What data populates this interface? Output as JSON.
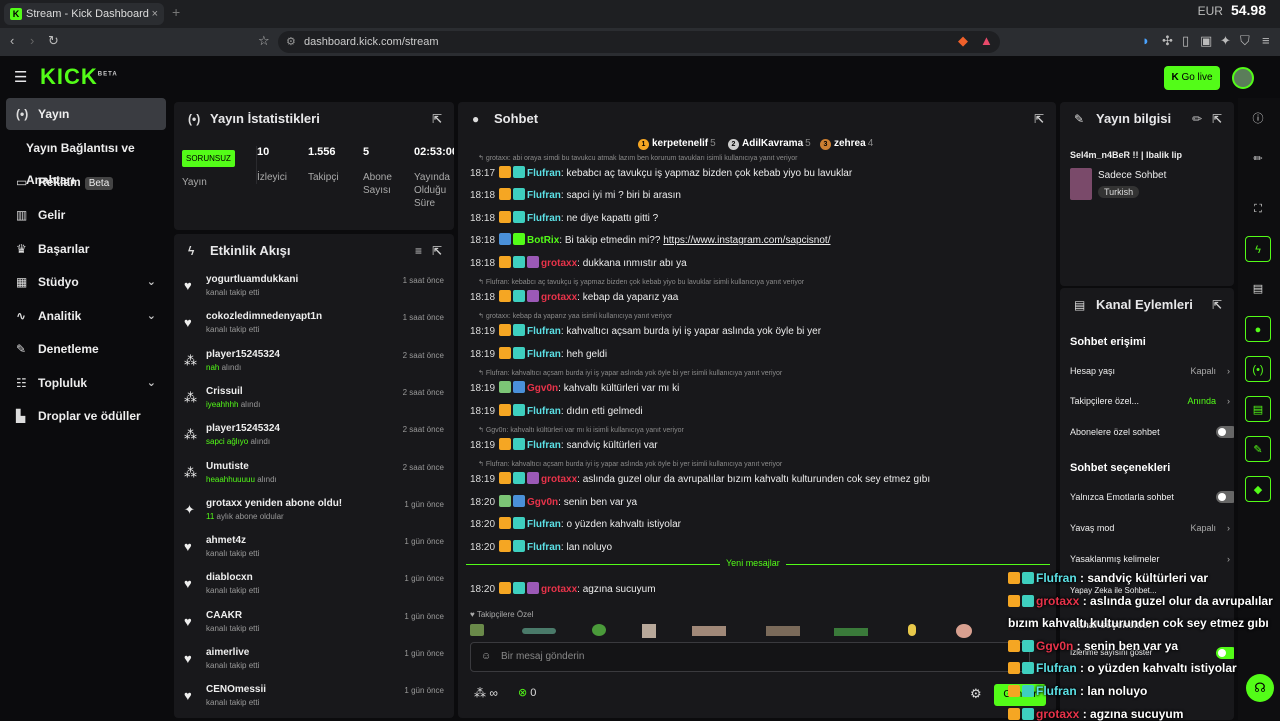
{
  "browser": {
    "tab_title": "Stream - Kick Dashboard",
    "new_tab": "+",
    "close": "×",
    "url": "dashboard.kick.com/stream",
    "ticker_label": "EUR",
    "ticker_value": "54.98"
  },
  "app": {
    "logo": "KICK",
    "logo_tag": "BETA",
    "go_live": "Go live"
  },
  "sidebar": {
    "items": [
      {
        "label": "Yayın",
        "icon": "broadcast-icon"
      },
      {
        "label": "Yayın Bağlantısı ve Anahtarı",
        "icon": ""
      },
      {
        "label": "Reklam",
        "icon": "tv-icon",
        "badge": "Beta"
      },
      {
        "label": "Gelir",
        "icon": "chart-icon"
      },
      {
        "label": "Başarılar",
        "icon": "trophy-icon"
      },
      {
        "label": "Stüdyo",
        "icon": "studio-icon"
      },
      {
        "label": "Analitik",
        "icon": "analytics-icon"
      },
      {
        "label": "Denetleme",
        "icon": "wrench-icon"
      },
      {
        "label": "Topluluk",
        "icon": "community-icon"
      },
      {
        "label": "Droplar ve ödüller",
        "icon": "drops-icon"
      }
    ]
  },
  "stats": {
    "title": "Yayın İstatistikleri",
    "status": "SORUNSUZ",
    "status_label": "Yayın",
    "viewers": "10",
    "viewers_label": "İzleyici",
    "followers": "1.556",
    "followers_label": "Takipçi",
    "subs": "5",
    "subs_label": "Abone Sayısı",
    "duration": "02:53:00",
    "duration_label": "Yayında Olduğu Süre"
  },
  "activity": {
    "title": "Etkinlik Akışı",
    "items": [
      {
        "name": "yogurtluamdukkani",
        "sub": "kanalı takip etti",
        "hl": "",
        "time": "1 saat önce",
        "icon": "heart-icon"
      },
      {
        "name": "cokozledimnedenyapt1n",
        "sub": "kanalı takip etti",
        "hl": "",
        "time": "1 saat önce",
        "icon": "heart-icon"
      },
      {
        "name": "player15245324",
        "sub": "alındı",
        "hl": "nah",
        "time": "2 saat önce",
        "icon": "reward-icon"
      },
      {
        "name": "Crissuil",
        "sub": "alındı",
        "hl": "iyeahhhh",
        "time": "2 saat önce",
        "icon": "reward-icon"
      },
      {
        "name": "player15245324",
        "sub": "alındı",
        "hl": "sapci ağlıyo",
        "time": "2 saat önce",
        "icon": "reward-icon"
      },
      {
        "name": "Umutiste",
        "sub": "alındı",
        "hl": "heaahhuuuuu",
        "time": "2 saat önce",
        "icon": "reward-icon"
      },
      {
        "name": "grotaxx yeniden abone oldu!",
        "sub": "aylık abone oldular",
        "hl": "11",
        "time": "1 gün önce",
        "icon": "star-icon"
      },
      {
        "name": "ahmet4z",
        "sub": "kanalı takip etti",
        "hl": "",
        "time": "1 gün önce",
        "icon": "heart-icon"
      },
      {
        "name": "diablocxn",
        "sub": "kanalı takip etti",
        "hl": "",
        "time": "1 gün önce",
        "icon": "heart-icon"
      },
      {
        "name": "CAAKR",
        "sub": "kanalı takip etti",
        "hl": "",
        "time": "1 gün önce",
        "icon": "heart-icon"
      },
      {
        "name": "aimerlive",
        "sub": "kanalı takip etti",
        "hl": "",
        "time": "1 gün önce",
        "icon": "heart-icon"
      },
      {
        "name": "CENOmessii",
        "sub": "kanalı takip etti",
        "hl": "",
        "time": "1 gün önce",
        "icon": "heart-icon"
      }
    ]
  },
  "chat": {
    "title": "Sohbet",
    "top": [
      {
        "rank": "1",
        "name": "kerpetenelif",
        "count": "5"
      },
      {
        "rank": "2",
        "name": "AdilKavrama",
        "count": "5"
      },
      {
        "rank": "3",
        "name": "zehrea",
        "count": "4"
      }
    ],
    "lines": [
      {
        "kind": "reply",
        "text": "grotaxx: abi oraya simdi bu tavukcu atmak lazım ben korurum tavukları isimli kullanıcıya yanıt veriyor"
      },
      {
        "kind": "msg",
        "time": "18:17",
        "user": "Flufran",
        "color": "#5ce1e6",
        "text": ": kebabcı aç tavukçu iş yapmaz bizden çok kebab yiyo bu lavuklar",
        "badges": [
          "#f5a623",
          "#3ecfbf"
        ]
      },
      {
        "kind": "msg",
        "time": "18:18",
        "user": "Flufran",
        "color": "#5ce1e6",
        "text": ": sapci iyi mi ? biri bi arasın",
        "badges": [
          "#f5a623",
          "#3ecfbf"
        ]
      },
      {
        "kind": "msg",
        "time": "18:18",
        "user": "Flufran",
        "color": "#5ce1e6",
        "text": ": ne diye kapattı gitti ?",
        "badges": [
          "#f5a623",
          "#3ecfbf"
        ]
      },
      {
        "kind": "msg",
        "time": "18:18",
        "user": "BotRix",
        "color": "#53fc18",
        "text": ": Bi takip etmedin mi?? ",
        "link": "https://www.instagram.com/sapcisnot/",
        "badges": [
          "#4a90d9",
          "#53fc18"
        ]
      },
      {
        "kind": "msg",
        "time": "18:18",
        "user": "grotaxx",
        "color": "#e8334a",
        "text": ": dukkana ınmıstır abı ya",
        "badges": [
          "#f5a623",
          "#3ecfbf",
          "#9b59b6"
        ]
      },
      {
        "kind": "reply",
        "text": "Flufran: kebabcı aç tavukçu iş yapmaz bizden çok kebab yiyo bu lavuklar isimli kullanıcıya yanıt veriyor"
      },
      {
        "kind": "msg",
        "time": "18:18",
        "user": "grotaxx",
        "color": "#e8334a",
        "text": ": kebap da yaparız yaa",
        "badges": [
          "#f5a623",
          "#3ecfbf",
          "#9b59b6"
        ]
      },
      {
        "kind": "reply",
        "text": "grotaxx: kebap da yaparız yaa isimli kullanıcıya yanıt veriyor"
      },
      {
        "kind": "msg",
        "time": "18:19",
        "user": "Flufran",
        "color": "#5ce1e6",
        "text": ": kahvaltıcı açsam burda iyi iş yapar aslında yok öyle bi yer",
        "badges": [
          "#f5a623",
          "#3ecfbf"
        ]
      },
      {
        "kind": "msg",
        "time": "18:19",
        "user": "Flufran",
        "color": "#5ce1e6",
        "text": ": heh geldi",
        "badges": [
          "#f5a623",
          "#3ecfbf"
        ]
      },
      {
        "kind": "reply",
        "text": "Flufran: kahvaltıcı açsam burda iyi iş yapar aslında yok öyle bi yer isimli kullanıcıya yanıt veriyor"
      },
      {
        "kind": "msg",
        "time": "18:19",
        "user": "Ggv0n",
        "color": "#e8334a",
        "text": ": kahvaltı kültürleri var mı ki",
        "badges": [
          "#7cc576",
          "#4a90d9"
        ]
      },
      {
        "kind": "msg",
        "time": "18:19",
        "user": "Flufran",
        "color": "#5ce1e6",
        "text": ": dıdın etti gelmedi",
        "badges": [
          "#f5a623",
          "#3ecfbf"
        ]
      },
      {
        "kind": "reply",
        "text": "Ggv0n: kahvaltı kültürleri var mı ki isimli kullanıcıya yanıt veriyor"
      },
      {
        "kind": "msg",
        "time": "18:19",
        "user": "Flufran",
        "color": "#5ce1e6",
        "text": ": sandviç kültürleri var",
        "badges": [
          "#f5a623",
          "#3ecfbf"
        ]
      },
      {
        "kind": "reply",
        "text": "Flufran: kahvaltıcı açsam burda iyi iş yapar aslında yok öyle bi yer isimli kullanıcıya yanıt veriyor"
      },
      {
        "kind": "msg",
        "time": "18:19",
        "user": "grotaxx",
        "color": "#e8334a",
        "text": ": aslında guzel olur da avrupalılar bızım kahvaltı kulturunden cok sey etmez gıbı",
        "badges": [
          "#f5a623",
          "#3ecfbf",
          "#9b59b6"
        ]
      },
      {
        "kind": "msg",
        "time": "18:20",
        "user": "Ggv0n",
        "color": "#e8334a",
        "text": ": senin ben var ya",
        "badges": [
          "#7cc576",
          "#4a90d9"
        ]
      },
      {
        "kind": "msg",
        "time": "18:20",
        "user": "Flufran",
        "color": "#5ce1e6",
        "text": ": o yüzden kahvaltı istiyolar",
        "badges": [
          "#f5a623",
          "#3ecfbf"
        ]
      },
      {
        "kind": "msg",
        "time": "18:20",
        "user": "Flufran",
        "color": "#5ce1e6",
        "text": ": lan noluyo",
        "badges": [
          "#f5a623",
          "#3ecfbf"
        ]
      }
    ],
    "new_messages": "Yeni mesajlar",
    "after": {
      "time": "18:20",
      "user": "grotaxx",
      "color": "#e8334a",
      "text": ": agzına sucuyum",
      "badges": [
        "#f5a623",
        "#3ecfbf",
        "#9b59b6"
      ]
    },
    "followers_only": "Takipçilere Özel",
    "input_placeholder": "Bir mesaj gönderin",
    "points": "∞",
    "kicks": "0",
    "send": "Gönder"
  },
  "info": {
    "title": "Yayın bilgisi",
    "stream_title": "Sel4m_n4BeR !! | Ibalik lip",
    "category": "Sadece Sohbet",
    "tag": "Turkish"
  },
  "actions": {
    "title": "Kanal Eylemleri",
    "chat_access": "Sohbet erişimi",
    "account_age": "Hesap yaşı",
    "account_age_value": "Kapalı",
    "followers_only": "Takipçilere özel...",
    "followers_only_value": "Anında",
    "subs_only": "Abonelere özel sohbet",
    "chat_options": "Sohbet seçenekleri",
    "emotes_only": "Yalnızca Emotlarla sohbet",
    "slow_mode": "Yavaş mod",
    "slow_mode_value": "Kapalı",
    "banned_words": "Yasaklanmış kelimeler",
    "ai": "Yapay Zeka ile Sohbet...",
    "channel_options": "Kanal seçenekleri",
    "show_viewers": "İzlenme sayısını göster"
  },
  "overlay": [
    {
      "user": "Flufran",
      "color": "#5ce1e6",
      "text": " : sandviç kültürleri var"
    },
    {
      "user": "grotaxx",
      "color": "#e8334a",
      "text": " : aslında guzel olur da avrupalılar"
    },
    {
      "user": "",
      "color": "#fff",
      "text": "bızım kahvaltı kulturunden cok sey etmez gıbı"
    },
    {
      "user": "Ggv0n",
      "color": "#e8334a",
      "text": " : senin ben var ya"
    },
    {
      "user": "Flufran",
      "color": "#5ce1e6",
      "text": " : o yüzden kahvaltı istiyolar"
    },
    {
      "user": "Flufran",
      "color": "#5ce1e6",
      "text": " : lan noluyo"
    },
    {
      "user": "grotaxx",
      "color": "#e8334a",
      "text": " : agzına sucuyum"
    }
  ]
}
